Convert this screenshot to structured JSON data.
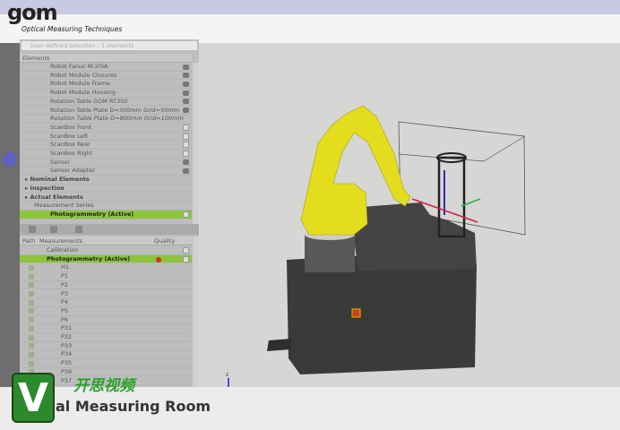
{
  "logo": {
    "brand": "gom",
    "tagline": "Optical Measuring Techniques"
  },
  "search": {
    "placeholder": "User-defined selection - 1 elements"
  },
  "elements": {
    "header": "Elements",
    "items": [
      {
        "label": "Robot Fanuc M-20iA",
        "vis": "eye"
      },
      {
        "label": "Robot Module Closures",
        "vis": "eye"
      },
      {
        "label": "Robot Module Frame",
        "vis": "eye"
      },
      {
        "label": "Robot Module Housing",
        "vis": "eye"
      },
      {
        "label": "Rotation Table GOM RT350",
        "vis": "eye"
      },
      {
        "label": "Rotation Table Plate D=300mm Grid=50mm",
        "vis": "eye"
      },
      {
        "label": "Rotation Table Plate D=800mm Grid=100mm",
        "vis": "none",
        "italic": true
      },
      {
        "label": "ScanBox Front",
        "vis": "box"
      },
      {
        "label": "ScanBox Left",
        "vis": "box"
      },
      {
        "label": "ScanBox Rear",
        "vis": "box"
      },
      {
        "label": "ScanBox Right",
        "vis": "box"
      },
      {
        "label": "Sensor",
        "vis": "eye"
      },
      {
        "label": "Sensor Adapter",
        "vis": "eye"
      }
    ],
    "groups": [
      {
        "label": "Nominal Elements"
      },
      {
        "label": "Inspection"
      },
      {
        "label": "Actual Elements"
      }
    ],
    "series": "Measurement Series",
    "active": "Photogrammetry (Active)"
  },
  "measurements": {
    "columns": [
      "Path",
      "Measurements",
      "Quality"
    ],
    "calibration": "Calibration",
    "active": "Photogrammetry (Active)",
    "items": [
      "H1",
      "P1",
      "P2",
      "P3",
      "P4",
      "P5",
      "P6",
      "P31",
      "P32",
      "P33",
      "P34",
      "P35",
      "P36",
      "P37"
    ]
  },
  "overlay": {
    "cn": "开思视频",
    "v": "V",
    "title": "al Measuring Room"
  },
  "axis": {
    "z": "z"
  },
  "colors": {
    "active": "#8cc43c",
    "robot": "#e6e020",
    "cell": "#3c3c3c"
  }
}
